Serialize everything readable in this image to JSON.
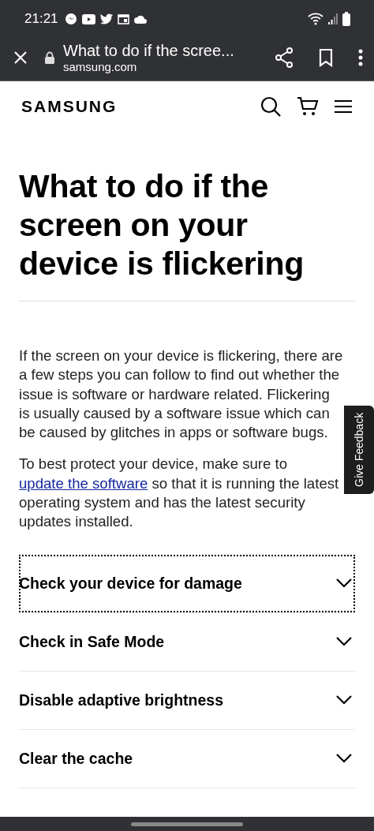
{
  "status_bar": {
    "time": "21:21"
  },
  "browser_bar": {
    "title": "What to do if the scree...",
    "domain": "samsung.com"
  },
  "site_header": {
    "logo": "SAMSUNG"
  },
  "article": {
    "title": "What to do if the screen on your device is flickering",
    "paragraphs": [
      {
        "text": "If the screen on your device is flickering, there are a few steps you can follow to find out whether the issue is software or hardware related. Flickering is usually caused by a software issue which can be caused by glitches in apps or software bugs."
      },
      {
        "before": "To best protect your device, make sure to ",
        "link": "update the software",
        "after": " so that it is running the latest operating system and has the latest security updates installed."
      }
    ]
  },
  "accordion": [
    {
      "label": "Check your device for damage",
      "focused": true,
      "expanded": false
    },
    {
      "label": "Check in Safe Mode",
      "focused": false,
      "expanded": false
    },
    {
      "label": "Disable adaptive brightness",
      "focused": false,
      "expanded": false
    },
    {
      "label": "Clear the cache",
      "focused": false,
      "expanded": false
    }
  ],
  "feedback_tab": {
    "label": "Give Feedback"
  }
}
